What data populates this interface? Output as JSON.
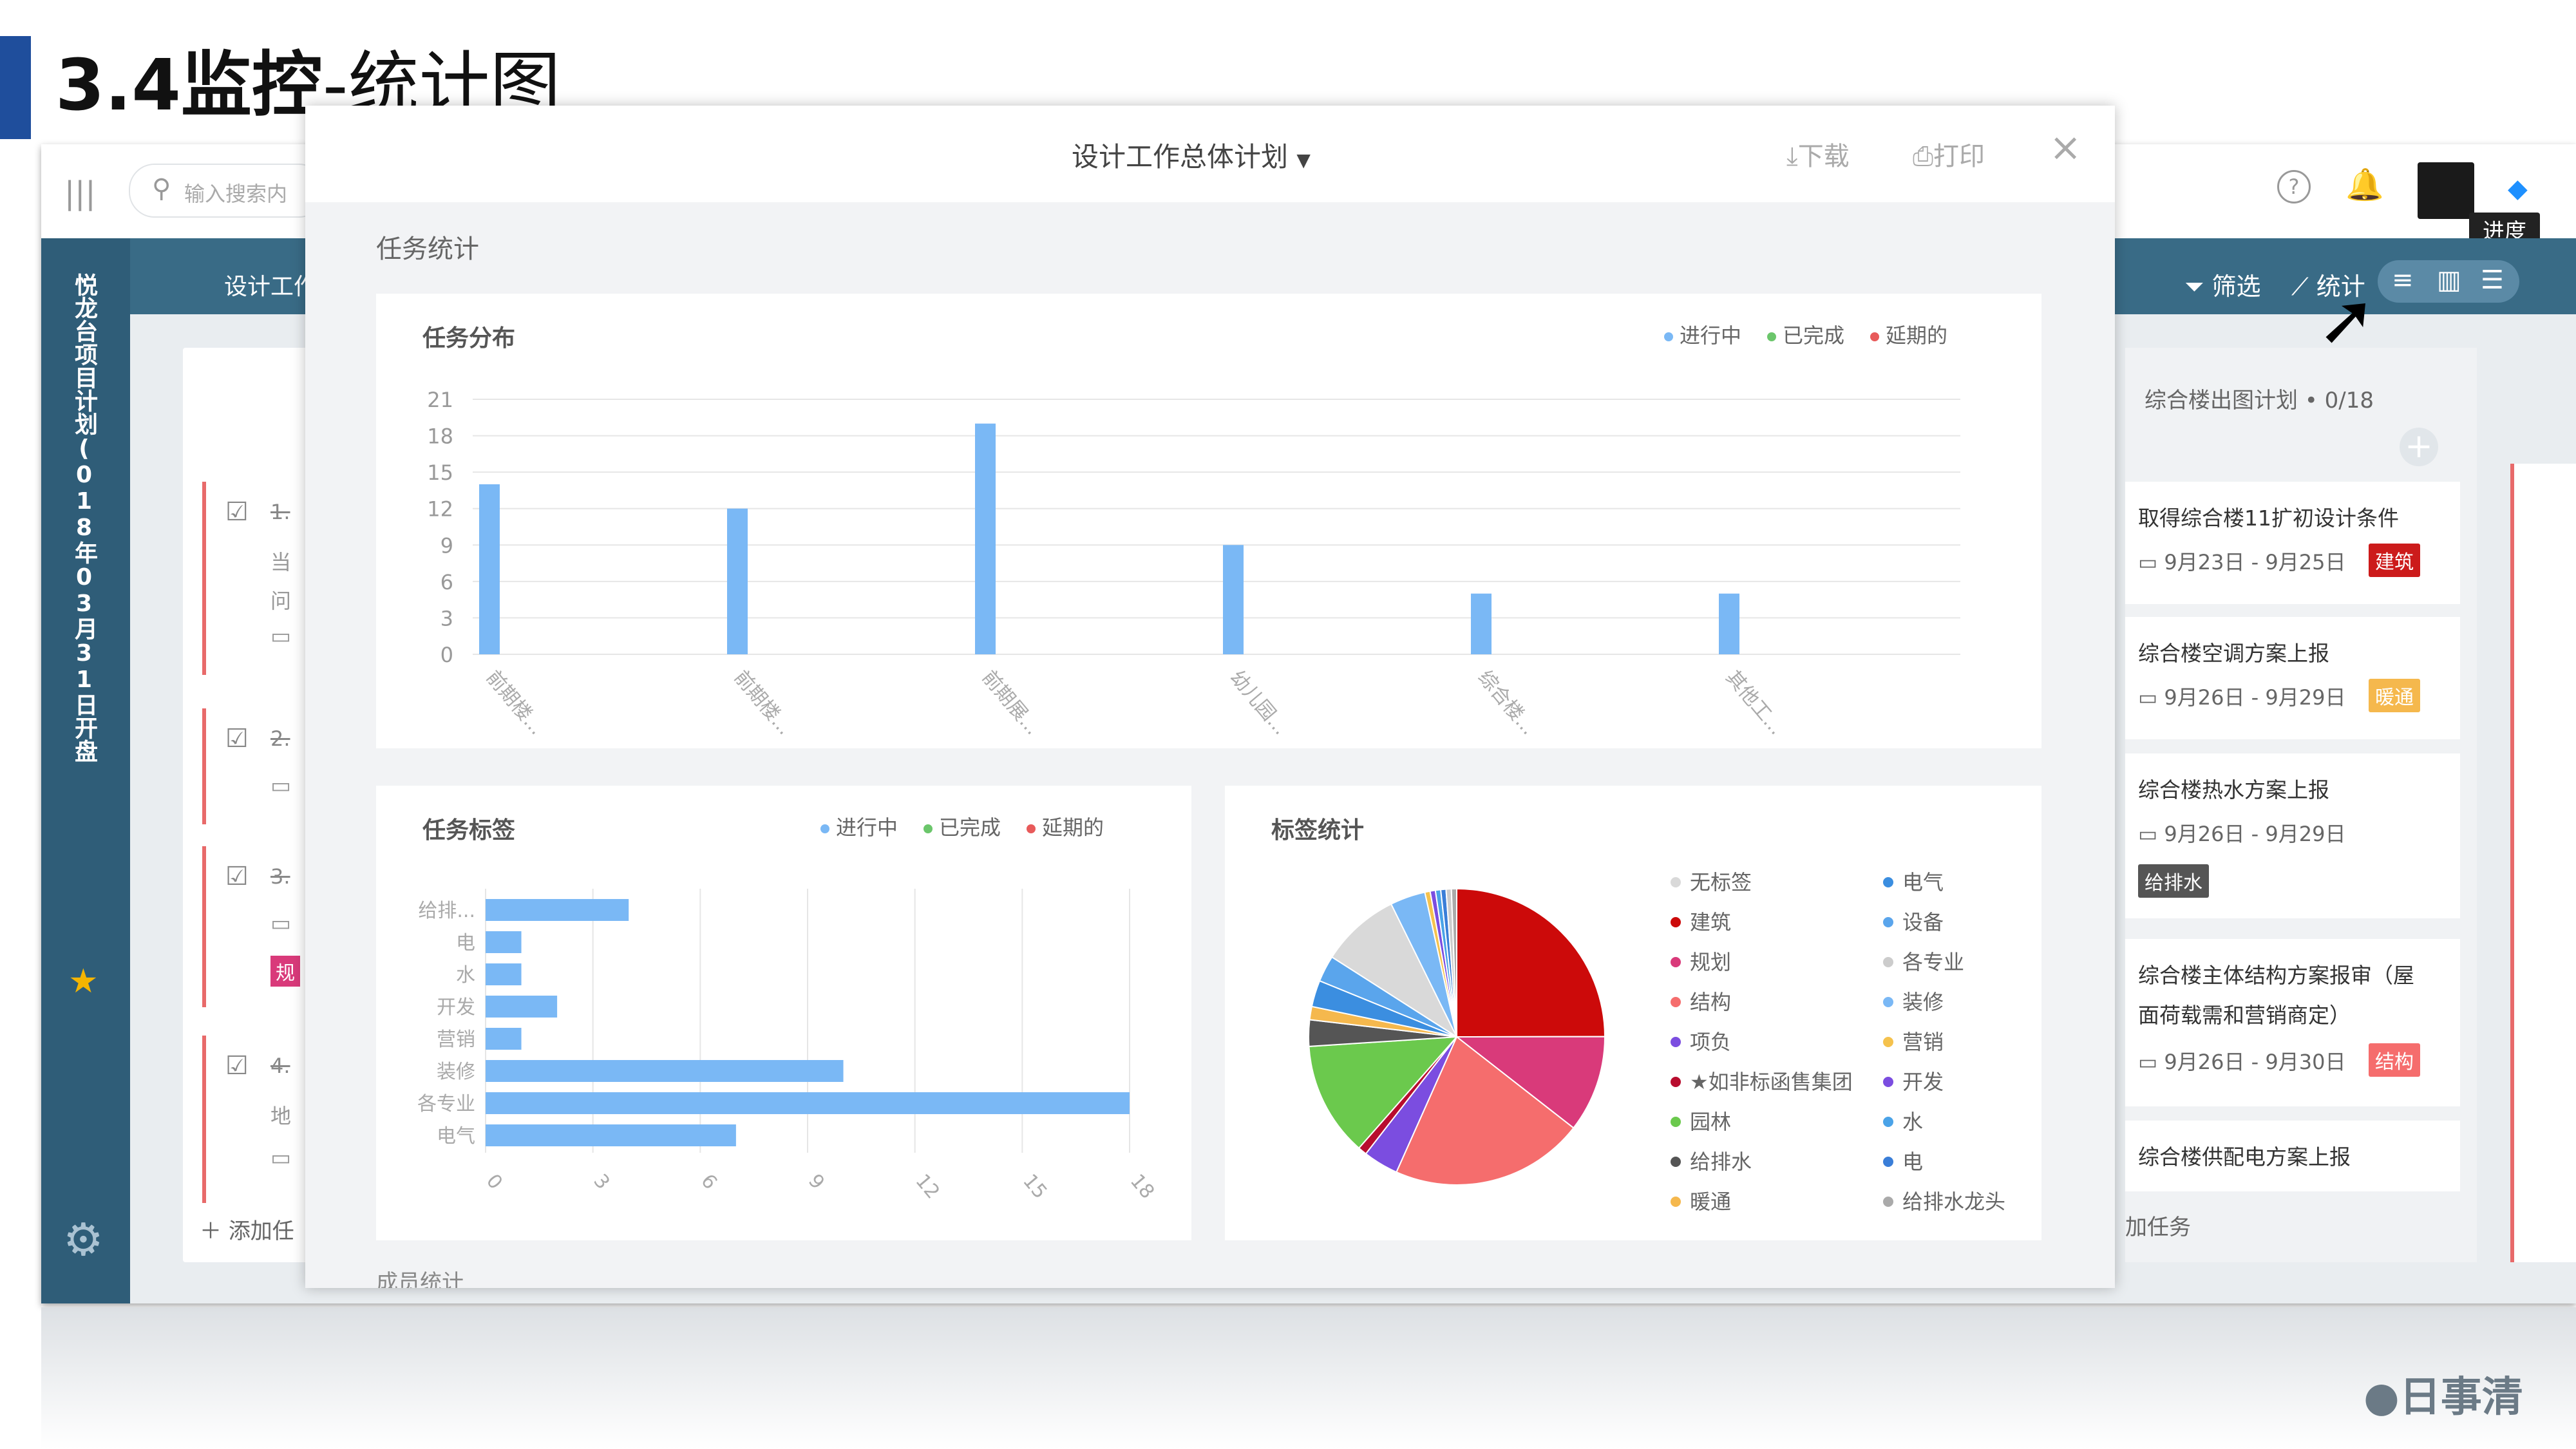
{
  "slide": {
    "title_prefix": "3.4监控",
    "title_suffix": "-统计图"
  },
  "topbar": {
    "search_placeholder": "输入搜索内",
    "menu_icon": "menu-icon",
    "help_icon": "help-icon",
    "bell_icon": "bell-icon"
  },
  "sidebar": {
    "project_title": "悦龙台项目计划(018年03月31日开盘",
    "settings_icon": "gear-icon"
  },
  "board": {
    "header_title": "设计工作总",
    "add_task": "添加任",
    "left_cards": [
      {
        "title": "1.",
        "line1": "当",
        "line2": "问"
      },
      {
        "title": "2."
      },
      {
        "title": "3.",
        "tag": "规"
      },
      {
        "title": "4.",
        "line1": "地"
      }
    ]
  },
  "toolbar": {
    "filter": "筛选",
    "stats": "统计",
    "tooltip": "进度"
  },
  "modal": {
    "title": "设计工作总体计划",
    "download": "下载",
    "print": "打印",
    "section": "任务统计",
    "bottom_label": "成员统计",
    "distribution_title": "任务分布",
    "tags_title": "任务标签",
    "tagstats_title": "标签统计",
    "legend": [
      {
        "name": "进行中",
        "color": "#7ab8f5"
      },
      {
        "name": "已完成",
        "color": "#6bc66b"
      },
      {
        "name": "延期的",
        "color": "#e85a5a"
      }
    ]
  },
  "chart_data": [
    {
      "type": "bar",
      "title": "任务分布",
      "categories": [
        "前期楼...",
        "前期楼...",
        "前期展...",
        "幼儿园...",
        "综合楼...",
        "其他工..."
      ],
      "series": [
        {
          "name": "进行中",
          "values": [
            14,
            12,
            19,
            9,
            5,
            5
          ]
        }
      ],
      "ylim": [
        0,
        21
      ],
      "yticks": [
        0,
        3,
        6,
        9,
        12,
        15,
        18,
        21
      ],
      "grid": true,
      "legend": "top-right"
    },
    {
      "type": "bar",
      "orientation": "horizontal",
      "title": "任务标签",
      "categories": [
        "给排...",
        "电",
        "水",
        "开发",
        "营销",
        "装修",
        "各专业",
        "电气"
      ],
      "series": [
        {
          "name": "进行中",
          "values": [
            4,
            1,
            1,
            2,
            1,
            10,
            18,
            7
          ]
        }
      ],
      "xlim": [
        0,
        18
      ],
      "xticks": [
        0,
        3,
        6,
        9,
        12,
        15,
        18
      ],
      "grid": true,
      "legend": "top-right"
    },
    {
      "type": "pie",
      "title": "标签统计",
      "slices": [
        {
          "name": "建筑",
          "value": 26,
          "color": "#cc0a0a"
        },
        {
          "name": "规划",
          "value": 11,
          "color": "#d93a7a"
        },
        {
          "name": "结构",
          "value": 22,
          "color": "#f56d6d"
        },
        {
          "name": "项负",
          "value": 4,
          "color": "#7b4de0"
        },
        {
          "name": "★如非标函售集团",
          "value": 1,
          "color": "#b80d2e"
        },
        {
          "name": "园林",
          "value": 13,
          "color": "#6bc94d"
        },
        {
          "name": "给排水",
          "value": 3,
          "color": "#555555"
        },
        {
          "name": "暖通",
          "value": 1.5,
          "color": "#f5b84d"
        },
        {
          "name": "电气",
          "value": 3,
          "color": "#3b8ee0"
        },
        {
          "name": "设备",
          "value": 3,
          "color": "#5aa5ec"
        },
        {
          "name": "无标签",
          "value": 9,
          "color": "#d9d9d9"
        },
        {
          "name": "装修",
          "value": 4,
          "color": "#7ab8f5"
        },
        {
          "name": "营销",
          "value": 0.6,
          "color": "#f5c24d"
        },
        {
          "name": "开发",
          "value": 0.6,
          "color": "#7b4de0"
        },
        {
          "name": "水",
          "value": 0.6,
          "color": "#4aa3e8"
        },
        {
          "name": "电",
          "value": 0.6,
          "color": "#3a7ed8"
        },
        {
          "name": "各专业",
          "value": 0.6,
          "color": "#cccccc"
        },
        {
          "name": "给排水龙头",
          "value": 0.6,
          "color": "#aaaaaa"
        }
      ],
      "legend_left": [
        {
          "name": "无标签",
          "color": "#d9d9d9"
        },
        {
          "name": "建筑",
          "color": "#cc0a0a"
        },
        {
          "name": "规划",
          "color": "#d93a7a"
        },
        {
          "name": "结构",
          "color": "#f56d6d"
        },
        {
          "name": "项负",
          "color": "#7b4de0"
        },
        {
          "name": "★如非标函售集团",
          "color": "#b80d2e"
        },
        {
          "name": "园林",
          "color": "#6bc94d"
        },
        {
          "name": "给排水",
          "color": "#555555"
        },
        {
          "name": "暖通",
          "color": "#f5b84d"
        }
      ],
      "legend_right": [
        {
          "name": "电气",
          "color": "#3b8ee0"
        },
        {
          "name": "设备",
          "color": "#5aa5ec"
        },
        {
          "name": "各专业",
          "color": "#cccccc"
        },
        {
          "name": "装修",
          "color": "#7ab8f5"
        },
        {
          "name": "营销",
          "color": "#f5c24d"
        },
        {
          "name": "开发",
          "color": "#7b4de0"
        },
        {
          "name": "水",
          "color": "#4aa3e8"
        },
        {
          "name": "电",
          "color": "#3a7ed8"
        },
        {
          "name": "给排水龙头",
          "color": "#aaaaaa"
        }
      ]
    }
  ],
  "right_column": {
    "header": "综合楼出图计划",
    "count": "0/18",
    "add_task": "加任务",
    "cards": [
      {
        "title": "取得综合楼11扩初设计条件",
        "date": "9月23日 - 9月25日",
        "tag": "建筑",
        "tag_color": "#cc1b1b"
      },
      {
        "title": "综合楼空调方案上报",
        "date": "9月26日 - 9月29日",
        "tag": "暖通",
        "tag_color": "#f5b84d"
      },
      {
        "title": "综合楼热水方案上报",
        "date": "9月26日 - 9月29日",
        "tag": "给排水",
        "tag_color": "#555555"
      },
      {
        "title": "综合楼主体结构方案报审（屋",
        "title2": "面荷载需和营销商定）",
        "date": "9月26日 - 9月30日",
        "tag": "结构",
        "tag_color": "#f56d6d"
      },
      {
        "title": "综合楼供配电方案上报"
      }
    ]
  },
  "brand": {
    "name": "日事清"
  }
}
